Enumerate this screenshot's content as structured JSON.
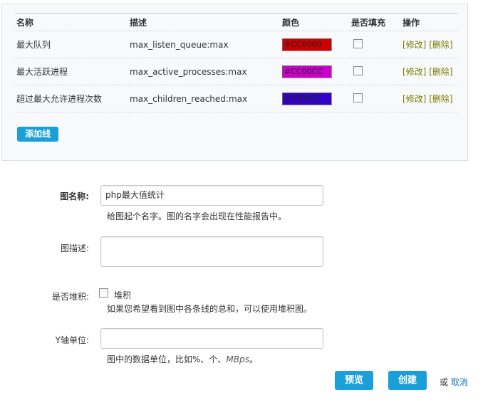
{
  "table": {
    "headers": [
      "名称",
      "描述",
      "颜色",
      "是否填充",
      "操作"
    ],
    "rows": [
      {
        "name": "最大队列",
        "desc": "max_listen_queue:max",
        "color": "#CC0000",
        "filled": false,
        "edit": "[修改]",
        "delete": "[删除]"
      },
      {
        "name": "最大活跃进程",
        "desc": "max_active_processes:max",
        "color": "#CC00CC",
        "filled": false,
        "edit": "[修改]",
        "delete": "[删除]"
      },
      {
        "name": "超过最大允许进程次数",
        "desc": "max_children_reached:max",
        "color": "#3300CC",
        "filled": false,
        "edit": "[修改]",
        "delete": "[删除]"
      }
    ],
    "add_line_label": "添加线"
  },
  "form": {
    "graph_name_label": "图名称:",
    "graph_name_value": "php最大值统计",
    "graph_name_hint": "给图起个名字。图的名字会出现在性能报告中。",
    "graph_desc_label": "图描述:",
    "graph_desc_value": "",
    "stack_label": "是否堆积:",
    "stack_checkbox_label": "堆积",
    "stack_hint": "如果您希望看到图中各条线的总和，可以使用堆积图。",
    "y_unit_label": "Y轴单位:",
    "y_unit_value": "",
    "y_unit_hint_prefix": "图中的数据单位，比如%、个、",
    "y_unit_hint_example": "MBps",
    "y_unit_hint_suffix": "。"
  },
  "actions": {
    "preview_label": "预览",
    "create_label": "创建",
    "or_text": "或",
    "cancel_label": "取消"
  },
  "colors": {
    "accent": "#1a9fd9",
    "link": "#1a73b8",
    "action_link": "#7a7a00"
  }
}
